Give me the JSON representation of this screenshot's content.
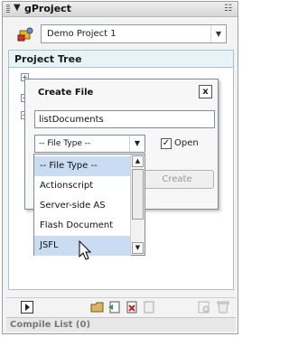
{
  "panel": {
    "title": "gProject"
  },
  "project": {
    "selected": "Demo Project 1"
  },
  "tree": {
    "header": "Project Tree"
  },
  "dialog": {
    "title": "Create File",
    "close_label": "x",
    "filename_value": "listDocuments",
    "filetype_selected": "-- File Type --",
    "open_label": "Open",
    "open_checked": "✓",
    "create_label": "Create"
  },
  "filetype_options": [
    "-- File Type --",
    "Actionscript",
    "Server-side AS",
    "Flash Document",
    "JSFL"
  ],
  "compile_list": {
    "label": "Compile List (0)"
  }
}
